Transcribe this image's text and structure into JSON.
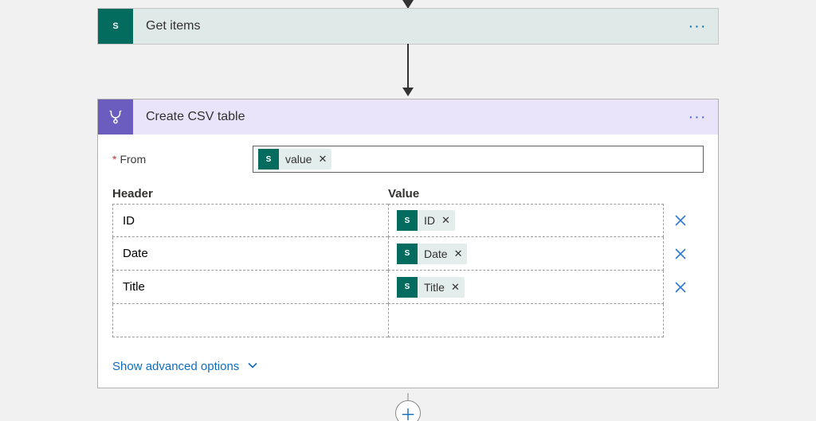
{
  "steps": {
    "getItems": {
      "title": "Get items",
      "iconLetter": "S"
    },
    "createCsv": {
      "title": "Create CSV table",
      "from": {
        "label": "From",
        "required": "*",
        "token": {
          "iconLetter": "S",
          "label": "value"
        }
      },
      "columns": {
        "headerLabel": "Header",
        "valueLabel": "Value",
        "rows": [
          {
            "header": "ID",
            "token": {
              "iconLetter": "S",
              "label": "ID"
            }
          },
          {
            "header": "Date",
            "token": {
              "iconLetter": "S",
              "label": "Date"
            }
          },
          {
            "header": "Title",
            "token": {
              "iconLetter": "S",
              "label": "Title"
            }
          }
        ]
      },
      "advanced": "Show advanced options"
    }
  }
}
